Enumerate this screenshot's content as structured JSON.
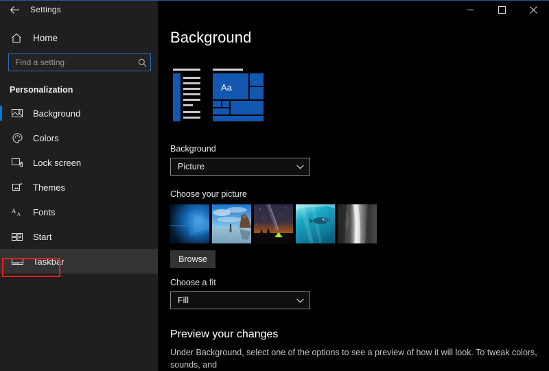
{
  "window": {
    "app_title": "Settings",
    "back_icon": "back-arrow-icon",
    "controls": {
      "minimize": "minimize-icon",
      "maximize": "maximize-icon",
      "close": "close-icon"
    }
  },
  "sidebar": {
    "home_label": "Home",
    "home_icon": "home-icon",
    "search": {
      "placeholder": "Find a setting",
      "value": "",
      "icon": "search-icon"
    },
    "section_title": "Personalization",
    "items": [
      {
        "label": "Background",
        "icon": "picture-icon",
        "selected": true,
        "hovered": false
      },
      {
        "label": "Colors",
        "icon": "palette-icon",
        "selected": false,
        "hovered": false
      },
      {
        "label": "Lock screen",
        "icon": "lockscreen-icon",
        "selected": false,
        "hovered": false
      },
      {
        "label": "Themes",
        "icon": "themes-icon",
        "selected": false,
        "hovered": false
      },
      {
        "label": "Fonts",
        "icon": "fonts-icon",
        "selected": false,
        "hovered": false
      },
      {
        "label": "Start",
        "icon": "start-icon",
        "selected": false,
        "hovered": false
      },
      {
        "label": "Taskbar",
        "icon": "taskbar-icon",
        "selected": false,
        "hovered": true
      }
    ],
    "annotation": {
      "target": "Taskbar",
      "color": "#ee1c25"
    }
  },
  "main": {
    "page_title": "Background",
    "preview": {
      "aa_text": "Aa",
      "accent_color": "#1257b0"
    },
    "background_label": "Background",
    "background_value": "Picture",
    "choose_picture_label": "Choose your picture",
    "thumbnails": [
      {
        "name": "windows-hero-light"
      },
      {
        "name": "beach-sea-stack"
      },
      {
        "name": "night-sky-tent"
      },
      {
        "name": "underwater-diver"
      },
      {
        "name": "rock-waterfall-bw"
      }
    ],
    "browse_label": "Browse",
    "fit_label": "Choose a fit",
    "fit_value": "Fill",
    "preview_heading": "Preview your changes",
    "preview_text": "Under Background, select one of the options to see a preview of how it will look. To tweak colors, sounds, and"
  },
  "colors": {
    "accent": "#0078d7",
    "sidebar_bg": "#1f1f1f",
    "content_bg": "#000000",
    "annotation": "#ee1c25"
  }
}
